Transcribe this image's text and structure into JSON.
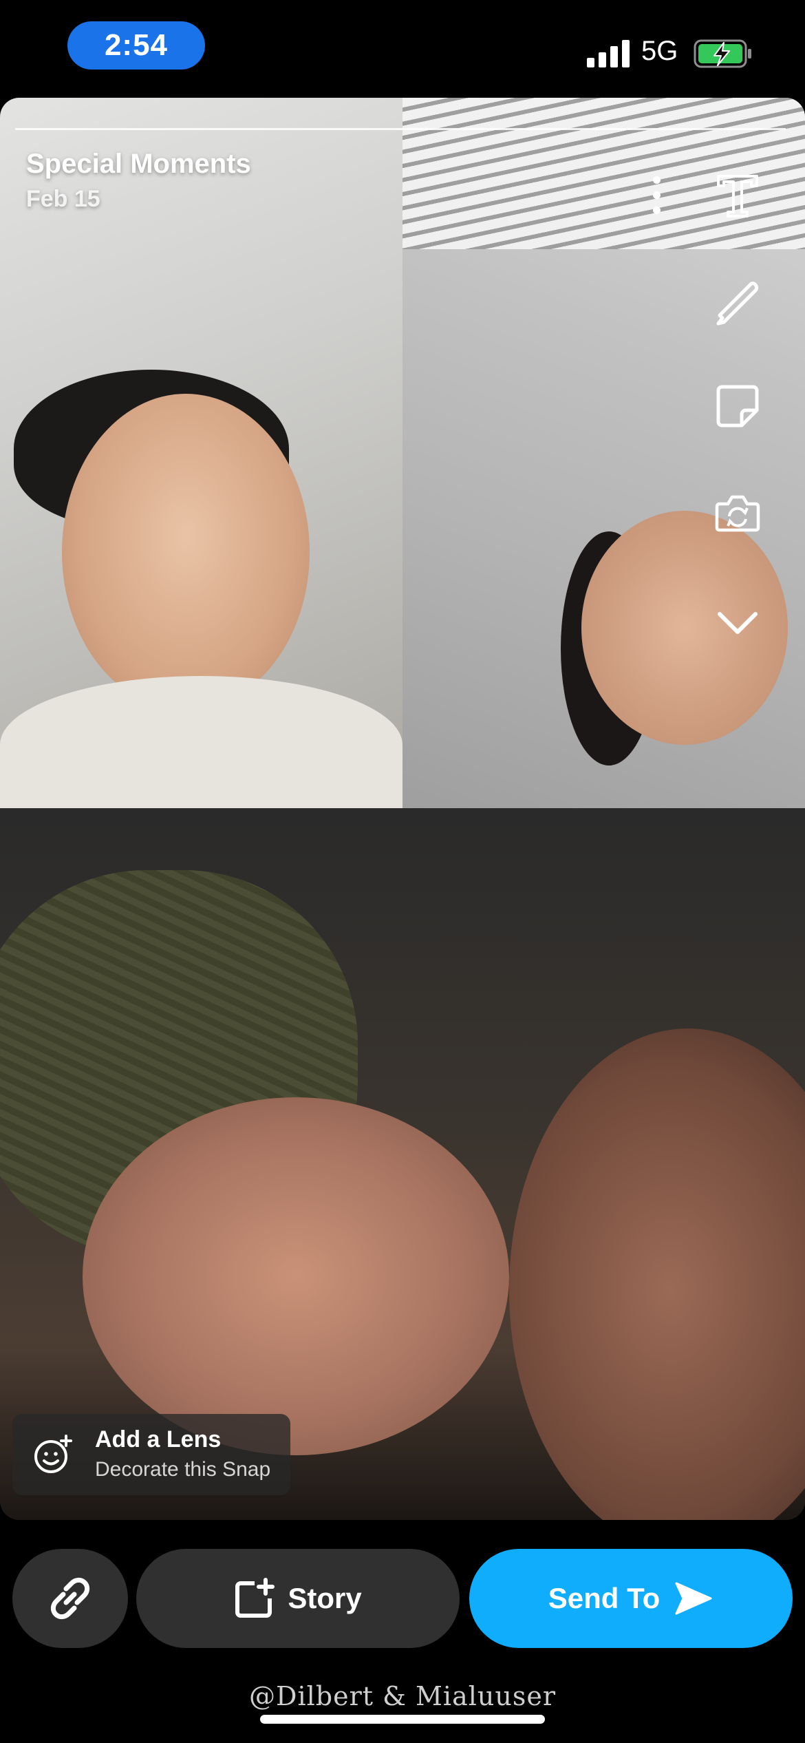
{
  "status_bar": {
    "time": "2:54",
    "network": "5G",
    "signal_bars": 4,
    "battery_state": "charging",
    "time_pill_color": "#1a73e8",
    "battery_color": "#34c759"
  },
  "memory": {
    "title": "Special Moments",
    "date": "Feb 15"
  },
  "toolbar": {
    "icons": [
      "text-icon",
      "pencil-icon",
      "sticker-icon",
      "camera-flip-icon",
      "chevron-down-icon"
    ],
    "more_icon": "more-vertical-icon"
  },
  "lens": {
    "title": "Add a Lens",
    "subtitle": "Decorate this Snap",
    "icon": "lens-face-icon"
  },
  "actions": {
    "link_icon": "link-icon",
    "story_label": "Story",
    "story_icon": "story-add-icon",
    "send_label": "Send To",
    "send_icon": "send-arrow-icon",
    "send_color": "#0fadfb"
  },
  "watermark": "@Dilbert & Mialuuser"
}
